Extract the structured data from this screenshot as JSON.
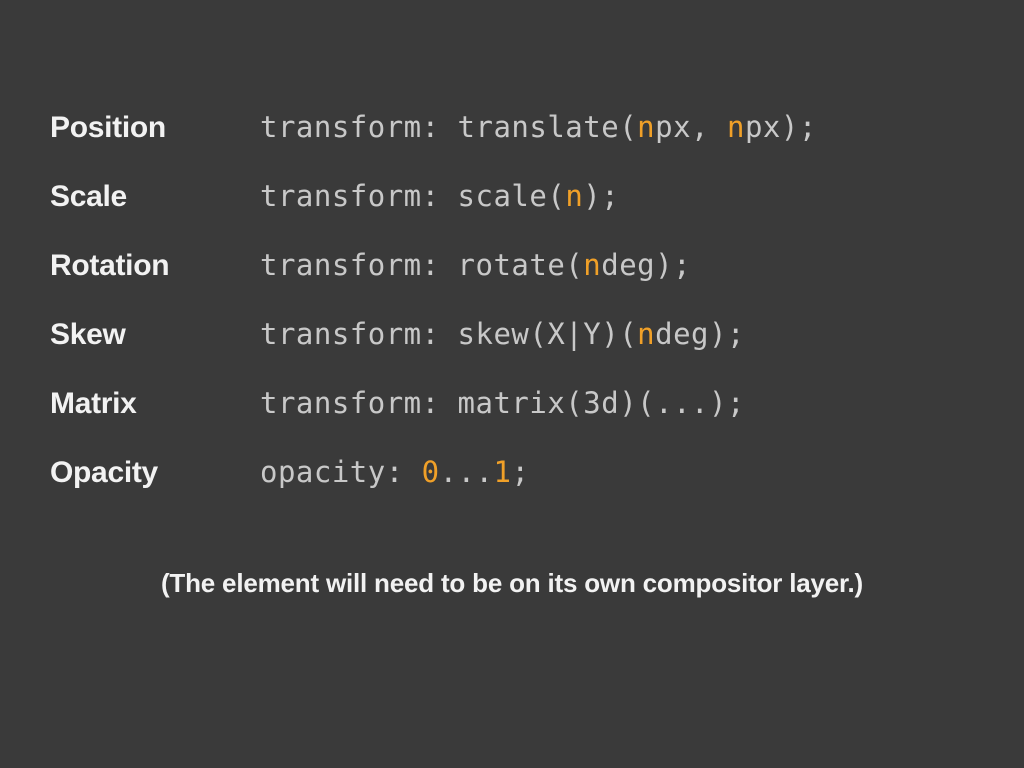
{
  "rows": [
    {
      "label": "Position",
      "code_pre": "transform: translate(",
      "hl1": "n",
      "mid1": "px, ",
      "hl2": "n",
      "mid2": "px);",
      "pattern": "two"
    },
    {
      "label": "Scale",
      "code_pre": "transform: scale(",
      "hl1": "n",
      "mid1": ");",
      "pattern": "one"
    },
    {
      "label": "Rotation",
      "code_pre": "transform: rotate(",
      "hl1": "n",
      "mid1": "deg);",
      "pattern": "one"
    },
    {
      "label": "Skew",
      "code_pre": "transform: skew(X|Y)(",
      "hl1": "n",
      "mid1": "deg);",
      "pattern": "one"
    },
    {
      "label": "Matrix",
      "code_pre": "transform: matrix(3d)(...);",
      "pattern": "plain"
    },
    {
      "label": "Opacity",
      "code_pre": "opacity: ",
      "hl1": "0",
      "mid1": "...",
      "hl2": "1",
      "mid2": ";",
      "pattern": "two"
    }
  ],
  "footnote": "(The element will need to be on its own compositor layer.)"
}
